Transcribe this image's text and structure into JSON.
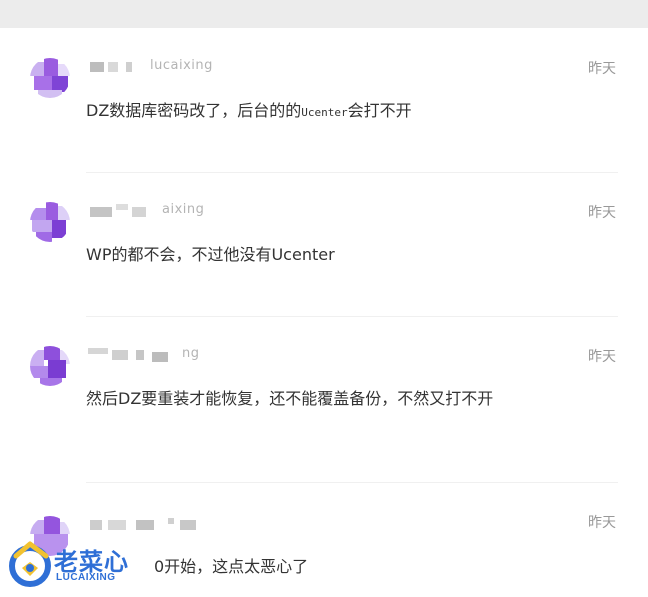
{
  "comments": [
    {
      "username_fragment": "lucaixing",
      "time": "昨天",
      "text_before": "DZ数据库密码改了，后台的的",
      "text_mono": "Ucenter",
      "text_after": "会打不开"
    },
    {
      "username_fragment": "aixing",
      "time": "昨天",
      "text_before": "WP的都不会，不过他没有Ucenter",
      "text_mono": "",
      "text_after": ""
    },
    {
      "username_fragment": "ng",
      "time": "昨天",
      "text_before": "然后DZ要重装才能恢复，还不能覆盖备份，不然又打不开",
      "text_mono": "",
      "text_after": ""
    },
    {
      "username_fragment": "",
      "time": "昨天",
      "text_before": "0开始，这点太恶心了",
      "text_mono": "",
      "text_after": ""
    }
  ],
  "watermark": {
    "title": "老菜心",
    "subtitle": "LUCAIXING"
  },
  "colors": {
    "avatar_purple": "#9a5ce0",
    "avatar_light": "#d7c3f3",
    "brand_blue": "#2f6fd6",
    "brand_yellow": "#f2c230"
  }
}
